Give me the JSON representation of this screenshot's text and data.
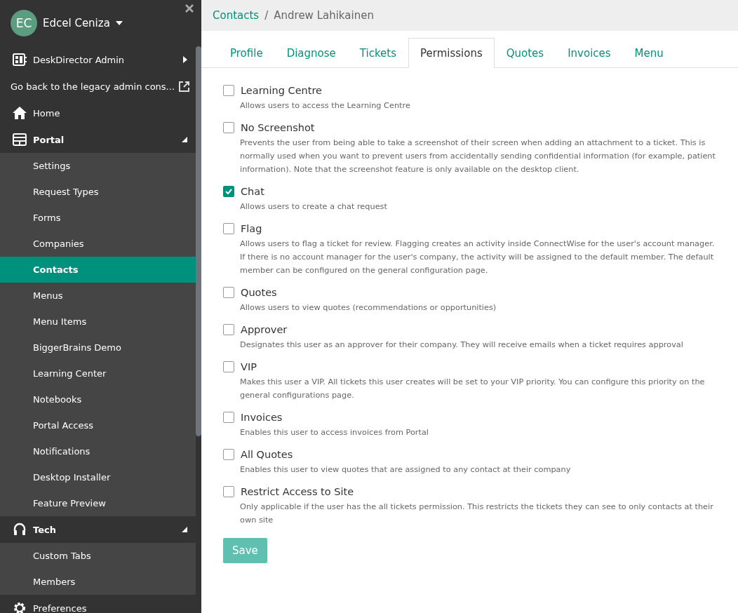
{
  "sidebar": {
    "user": {
      "initials": "EC",
      "name": "Edcel Ceniza"
    },
    "items": [
      {
        "kind": "link",
        "label": "DeskDirector Admin",
        "selected": false
      },
      {
        "kind": "link",
        "label": "Go back to the legacy admin cons...",
        "selected": false
      },
      {
        "kind": "link",
        "label": "Home",
        "selected": false
      },
      {
        "kind": "section",
        "label": "Portal",
        "expanded": true,
        "children": [
          {
            "label": "Settings",
            "selected": false
          },
          {
            "label": "Request Types",
            "selected": false
          },
          {
            "label": "Forms",
            "selected": false
          },
          {
            "label": "Companies",
            "selected": false
          },
          {
            "label": "Contacts",
            "selected": true
          },
          {
            "label": "Menus",
            "selected": false
          },
          {
            "label": "Menu Items",
            "selected": false
          },
          {
            "label": "BiggerBrains Demo",
            "selected": false
          },
          {
            "label": "Learning Center",
            "selected": false
          },
          {
            "label": "Notebooks",
            "selected": false
          },
          {
            "label": "Portal Access",
            "selected": false
          },
          {
            "label": "Notifications",
            "selected": false
          },
          {
            "label": "Desktop Installer",
            "selected": false
          },
          {
            "label": "Feature Preview",
            "selected": false
          }
        ]
      },
      {
        "kind": "section",
        "label": "Tech",
        "expanded": true,
        "children": [
          {
            "label": "Custom Tabs",
            "selected": false
          },
          {
            "label": "Members",
            "selected": false
          }
        ]
      },
      {
        "kind": "link",
        "label": "Preferences",
        "selected": false
      }
    ]
  },
  "breadcrumb": [
    {
      "label": "Contacts",
      "link": true
    },
    {
      "label": "/",
      "link": false
    },
    {
      "label": "Andrew Lahikainen",
      "link": false
    }
  ],
  "tabs": [
    {
      "label": "Profile",
      "selected": false
    },
    {
      "label": "Diagnose",
      "selected": false
    },
    {
      "label": "Tickets",
      "selected": false
    },
    {
      "label": "Permissions",
      "selected": true
    },
    {
      "label": "Quotes",
      "selected": false
    },
    {
      "label": "Invoices",
      "selected": false
    },
    {
      "label": "Menu",
      "selected": false
    }
  ],
  "permissions": [
    {
      "label": "Learning Centre",
      "checked": false,
      "description": "Allows users to access the Learning Centre"
    },
    {
      "label": "No Screenshot",
      "checked": false,
      "description": "Prevents the user from being able to take a screenshot of their screen when adding an attachment to a ticket. This is normally used when you want to prevent users from accidentally sending confidential information (for example, patient information). Note that the screenshot feature is only available on the desktop client."
    },
    {
      "label": "Chat",
      "checked": true,
      "description": "Allows users to create a chat request"
    },
    {
      "label": "Flag",
      "checked": false,
      "description": "Allows users to flag a ticket for review. Flagging creates an activity inside ConnectWise for the user's account manager. If there is no account manager for the user's company, the activity will be assigned to the default member. The default member can be configured on the general configuration page."
    },
    {
      "label": "Quotes",
      "checked": false,
      "description": "Allows users to view quotes (recommendations or opportunities)"
    },
    {
      "label": "Approver",
      "checked": false,
      "description": "Designates this user as an approver for their company. They will receive emails when a ticket requires approval"
    },
    {
      "label": "VIP",
      "checked": false,
      "description": "Makes this user a VIP. All tickets this user creates will be set to your VIP priority. You can configure this priority on the general configurations page."
    },
    {
      "label": "Invoices",
      "checked": false,
      "description": "Enables this user to access invoices from Portal"
    },
    {
      "label": "All Quotes",
      "checked": false,
      "description": "Enables this user to view quotes that are assigned to any contact at their company"
    },
    {
      "label": "Restrict Access to Site",
      "checked": false,
      "description": "Only applicable if the user has the all tickets permission. This restricts the tickets they can see to only contacts at their own site"
    }
  ],
  "save_button": "Save"
}
